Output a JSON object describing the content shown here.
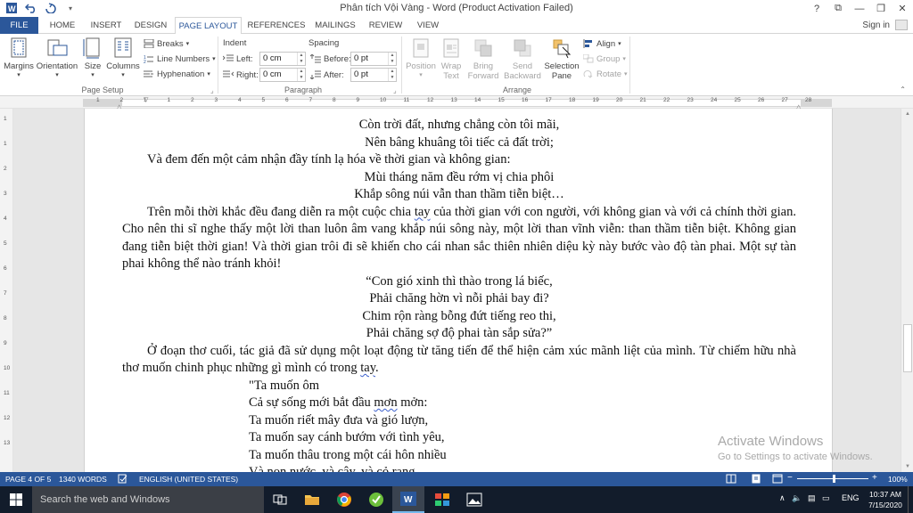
{
  "window": {
    "title": "Phân tích Vội Vàng - Word (Product Activation Failed)",
    "controls": [
      "?",
      "⧉",
      "—",
      "❐",
      "✕"
    ]
  },
  "quick_access": {
    "items": [
      "word-icon",
      "undo-icon",
      "redo-icon",
      "customize-icon"
    ]
  },
  "tabs": [
    {
      "label": "FILE"
    },
    {
      "label": "HOME"
    },
    {
      "label": "INSERT"
    },
    {
      "label": "DESIGN"
    },
    {
      "label": "PAGE LAYOUT"
    },
    {
      "label": "REFERENCES"
    },
    {
      "label": "MAILINGS"
    },
    {
      "label": "REVIEW"
    },
    {
      "label": "VIEW"
    }
  ],
  "signin_label": "Sign in",
  "ribbon": {
    "page_setup": {
      "label": "Page Setup",
      "margins": "Margins",
      "orientation": "Orientation",
      "size": "Size",
      "columns": "Columns",
      "breaks": "Breaks",
      "line_numbers": "Line Numbers",
      "hyphenation": "Hyphenation"
    },
    "paragraph": {
      "label": "Paragraph",
      "indent_header": "Indent",
      "spacing_header": "Spacing",
      "left_label": "Left:",
      "left_value": "0 cm",
      "right_label": "Right:",
      "right_value": "0 cm",
      "before_label": "Before:",
      "before_value": "0 pt",
      "after_label": "After:",
      "after_value": "0 pt"
    },
    "arrange": {
      "label": "Arrange",
      "position_1": "Position",
      "wrap_1": "Wrap",
      "wrap_2": "Text",
      "bring_1": "Bring",
      "bring_2": "Forward",
      "send_1": "Send",
      "send_2": "Backward",
      "selection_1": "Selection",
      "selection_2": "Pane",
      "align": "Align",
      "group": "Group",
      "rotate": "Rotate"
    }
  },
  "ruler": {
    "h_ticks": [
      "1",
      "2",
      "1",
      "1",
      "2",
      "3",
      "4",
      "5",
      "6",
      "7",
      "8",
      "9",
      "10",
      "11",
      "12",
      "13",
      "14",
      "15",
      "16",
      "17",
      "18",
      "19",
      "20",
      "21",
      "22",
      "23",
      "24",
      "25",
      "26",
      "27",
      "28"
    ],
    "v_ticks": [
      "1",
      "1",
      "2",
      "3",
      "4",
      "5",
      "6",
      "7",
      "8",
      "9",
      "10",
      "11",
      "12",
      "13"
    ]
  },
  "document": {
    "lines": [
      {
        "style": "c",
        "text": "Còn trời đất, nhưng chẳng còn tôi mãi,"
      },
      {
        "style": "c",
        "text": "Nên bâng khuâng tôi tiếc cả đất trời;"
      },
      {
        "style": "j",
        "text": "Và đem đến một cảm nhận đầy tính lạ hóa về thời gian và không gian:"
      },
      {
        "style": "c",
        "text": "Mùi tháng năm đều rớm vị chia phôi"
      },
      {
        "style": "c",
        "text": "Khắp sông núi vẫn than thầm tiễn biệt…"
      }
    ],
    "para1_a": "Trên mỗi thời khắc đều đang diễn ra một cuộc chia ",
    "para1_tay": "tay",
    "para1_b": " của thời gian với con người, với không gian và với cả chính thời gian. Cho nên thi sĩ nghe thấy một lời than luôn âm vang khắp núi sông này, một lời than vĩnh viễn: than thầm tiễn biệt. Không gian đang tiễn biệt thời gian! Và thời gian trôi đi sẽ khiến cho cái nhan sắc thiên nhiên diệu kỳ này bước vào độ tàn phai. Một sự tàn phai không thể nào tránh khỏi!",
    "verse2": [
      "“Con gió xinh thì thào trong lá biếc,",
      "Phải chăng hờn vì nỗi phải bay đi?",
      "Chim rộn ràng bỗng đứt tiếng reo thi,",
      "Phải chăng sợ độ phai tàn sắp sửa?”"
    ],
    "para2_a": "Ở đoạn thơ cuối, tác giả đã sử dụng một loạt động từ tăng tiến để thể hiện cảm xúc mãnh liệt của mình. Từ chiếm hữu nhà thơ muốn chinh phục những gì mình có trong ",
    "para2_tay": "tay",
    "para2_b": ".",
    "verse3_1": "\"Ta muốn ôm",
    "verse3_2a": "Cả sự sống mới bắt đầu ",
    "verse3_2b": "mơn",
    "verse3_2c": " mởn:",
    "verse3_3": "Ta muốn riết mây đưa và gió lượn,",
    "verse3_4": "Ta muốn say cánh bướm với tình yêu,",
    "verse3_5": "Ta muốn thâu trong một cái hôn nhiều",
    "verse3_6": "Và non nước, và cây, và cỏ rạng,"
  },
  "activation": {
    "title": "Activate Windows",
    "subtitle": "Go to Settings to activate Windows."
  },
  "status": {
    "page": "PAGE 4 OF 5",
    "words": "1340 WORDS",
    "language": "ENGLISH (UNITED STATES)",
    "zoom": "100%",
    "zoom_level": 100
  },
  "taskbar": {
    "search_placeholder": "Search the web and Windows",
    "language": "ENG",
    "time": "10:37 AM",
    "date": "7/15/2020"
  },
  "colors": {
    "accent": "#2b579a",
    "taskbar": "#121c2b"
  }
}
